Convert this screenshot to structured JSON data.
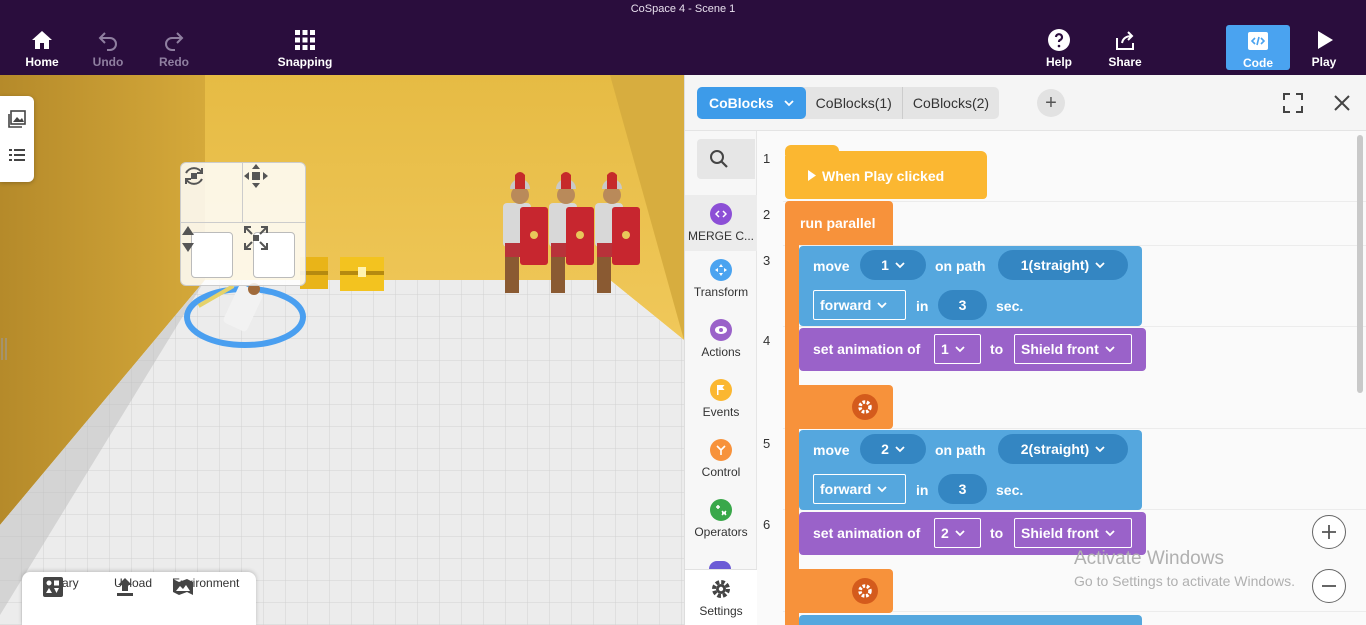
{
  "window": {
    "title": "CoSpace 4 - Scene 1"
  },
  "toolbar": {
    "home": "Home",
    "undo": "Undo",
    "redo": "Redo",
    "snapping": "Snapping",
    "help": "Help",
    "share": "Share",
    "code": "Code",
    "play": "Play"
  },
  "scene": {
    "bottom": {
      "library": "Library",
      "upload": "Upload",
      "environment": "Environment"
    }
  },
  "tabs": {
    "active": "CoBlocks",
    "second": "CoBlocks(1)",
    "third": "CoBlocks(2)",
    "add": "+"
  },
  "palette": {
    "categories": [
      "MERGE C...",
      "Transform",
      "Actions",
      "Events",
      "Control",
      "Operators"
    ],
    "settings": "Settings"
  },
  "code": {
    "line_numbers": [
      "1",
      "2",
      "3",
      "4",
      "5",
      "6"
    ],
    "when_play": "When Play clicked",
    "run_parallel": "run parallel",
    "move_label": "move",
    "on_path_label": "on path",
    "in_label": "in",
    "sec_label": "sec.",
    "set_anim_label": "set animation of",
    "to_label": "to",
    "move1": {
      "item": "1",
      "path": "1(straight)",
      "direction": "forward",
      "duration": "3"
    },
    "anim1": {
      "item": "1",
      "animation": "Shield front"
    },
    "move2": {
      "item": "2",
      "path": "2(straight)",
      "direction": "forward",
      "duration": "3"
    },
    "anim2": {
      "item": "2",
      "animation": "Shield front"
    }
  },
  "watermark": {
    "line1": "Activate Windows",
    "line2": "Go to Settings to activate Windows."
  },
  "colors": {
    "topbar": "#2a0d3d",
    "accent": "#4aa3f0",
    "events_block": "#fbb731",
    "control_block": "#f7923b",
    "motion_block": "#55a7de",
    "animation_block": "#9a62c9"
  }
}
